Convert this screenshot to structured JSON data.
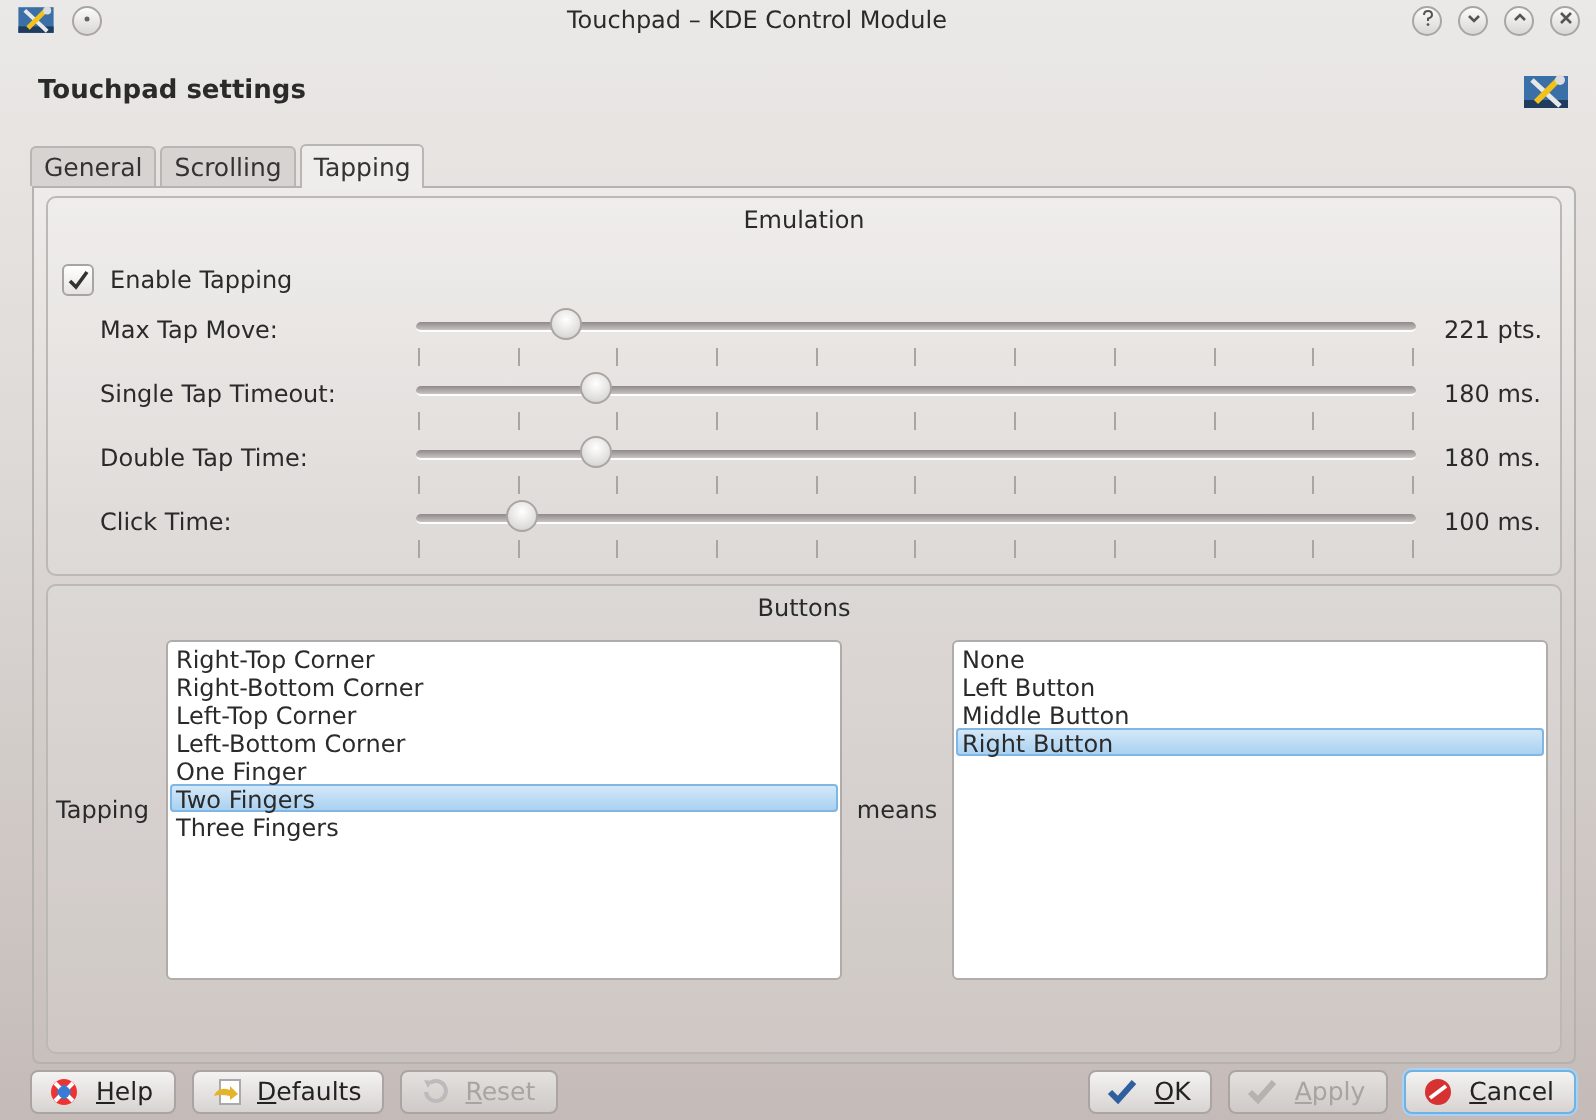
{
  "window": {
    "title": "Touchpad – KDE Control Module"
  },
  "header": {
    "title": "Touchpad settings"
  },
  "tabs": [
    {
      "label": "General",
      "selected": false
    },
    {
      "label": "Scrolling",
      "selected": false
    },
    {
      "label": "Tapping",
      "selected": true
    }
  ],
  "emulation": {
    "title": "Emulation",
    "enable": {
      "label": "Enable Tapping",
      "checked": true
    },
    "sliders": [
      {
        "label": "Max Tap Move:",
        "level": 0.15,
        "reading": "221 pts."
      },
      {
        "label": "Single Tap Timeout:",
        "level": 0.18,
        "reading": "180 ms."
      },
      {
        "label": "Double Tap Time:",
        "level": 0.18,
        "reading": "180 ms."
      },
      {
        "label": "Click Time:",
        "level": 0.105,
        "reading": "100 ms."
      }
    ]
  },
  "buttons_group": {
    "title": "Buttons",
    "tapping_label": "Tapping",
    "means_label": "means",
    "gestures": [
      {
        "label": "Right-Top Corner",
        "selected": false
      },
      {
        "label": "Right-Bottom Corner",
        "selected": false
      },
      {
        "label": "Left-Top Corner",
        "selected": false
      },
      {
        "label": "Left-Bottom Corner",
        "selected": false
      },
      {
        "label": "One Finger",
        "selected": false
      },
      {
        "label": "Two Fingers",
        "selected": true
      },
      {
        "label": "Three Fingers",
        "selected": false
      }
    ],
    "actions": [
      {
        "label": "None",
        "selected": false
      },
      {
        "label": "Left Button",
        "selected": false
      },
      {
        "label": "Middle Button",
        "selected": false
      },
      {
        "label": "Right Button",
        "selected": true
      }
    ]
  },
  "footer_left": [
    {
      "label": "Help",
      "kind": "help",
      "disabled": false
    },
    {
      "label": "Defaults",
      "kind": "defaults",
      "disabled": false
    },
    {
      "label": "Reset",
      "kind": "reset",
      "disabled": true
    }
  ],
  "footer_right": [
    {
      "label": "OK",
      "kind": "ok",
      "disabled": false
    },
    {
      "label": "Apply",
      "kind": "apply",
      "disabled": true
    },
    {
      "label": "Cancel",
      "kind": "cancel",
      "disabled": false
    }
  ]
}
